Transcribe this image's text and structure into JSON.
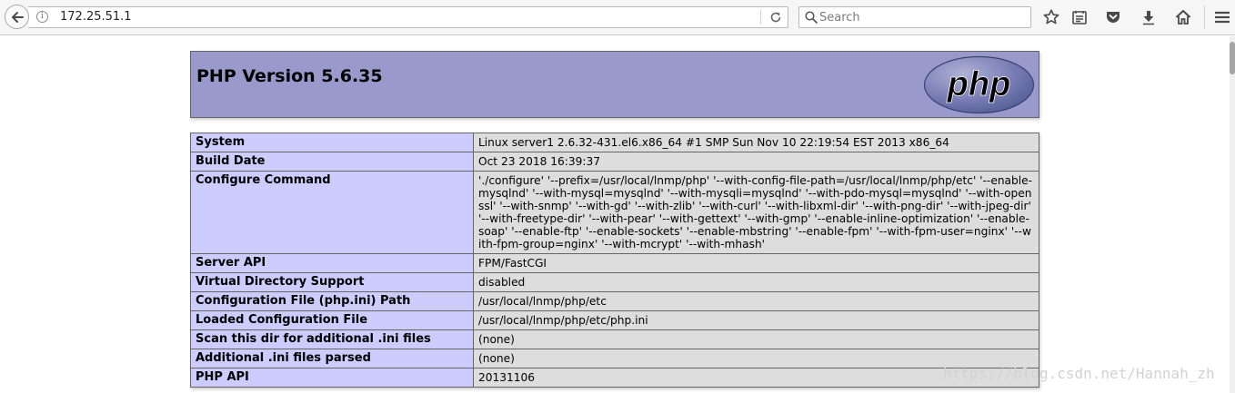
{
  "browser": {
    "url": "172.25.51.1",
    "search_placeholder": "Search",
    "icons": [
      "back-arrow-icon",
      "info-icon",
      "reload-icon",
      "search-icon",
      "bookmark-star-icon",
      "reading-list-icon",
      "pocket-icon",
      "download-icon",
      "home-icon",
      "hamburger-menu-icon"
    ]
  },
  "phpinfo": {
    "title": "PHP Version 5.6.35",
    "logo_text": "php",
    "rows": [
      {
        "label": "System",
        "value": "Linux server1 2.6.32-431.el6.x86_64 #1 SMP Sun Nov 10 22:19:54 EST 2013 x86_64"
      },
      {
        "label": "Build Date",
        "value": "Oct 23 2018 16:39:37"
      },
      {
        "label": "Configure Command",
        "value": "'./configure' '--prefix=/usr/local/lnmp/php' '--with-config-file-path=/usr/local/lnmp/php/etc' '--enable-mysqlnd' '--with-mysql=mysqlnd' '--with-mysqli=mysqlnd' '--with-pdo-mysql=mysqlnd' '--with-openssl' '--with-snmp' '--with-gd' '--with-zlib' '--with-curl' '--with-libxml-dir' '--with-png-dir' '--with-jpeg-dir' '--with-freetype-dir' '--with-pear' '--with-gettext' '--with-gmp' '--enable-inline-optimization' '--enable-soap' '--enable-ftp' '--enable-sockets' '--enable-mbstring' '--enable-fpm' '--with-fpm-user=nginx' '--with-fpm-group=nginx' '--with-mcrypt' '--with-mhash'"
      },
      {
        "label": "Server API",
        "value": "FPM/FastCGI"
      },
      {
        "label": "Virtual Directory Support",
        "value": "disabled"
      },
      {
        "label": "Configuration File (php.ini) Path",
        "value": "/usr/local/lnmp/php/etc"
      },
      {
        "label": "Loaded Configuration File",
        "value": "/usr/local/lnmp/php/etc/php.ini"
      },
      {
        "label": "Scan this dir for additional .ini files",
        "value": "(none)"
      },
      {
        "label": "Additional .ini files parsed",
        "value": "(none)"
      },
      {
        "label": "PHP API",
        "value": "20131106"
      }
    ]
  },
  "watermark": "https://blog.csdn.net/Hannah_zh",
  "colors": {
    "header_bg": "#9999cc",
    "label_bg": "#ccccff",
    "value_bg": "#dddddd"
  }
}
